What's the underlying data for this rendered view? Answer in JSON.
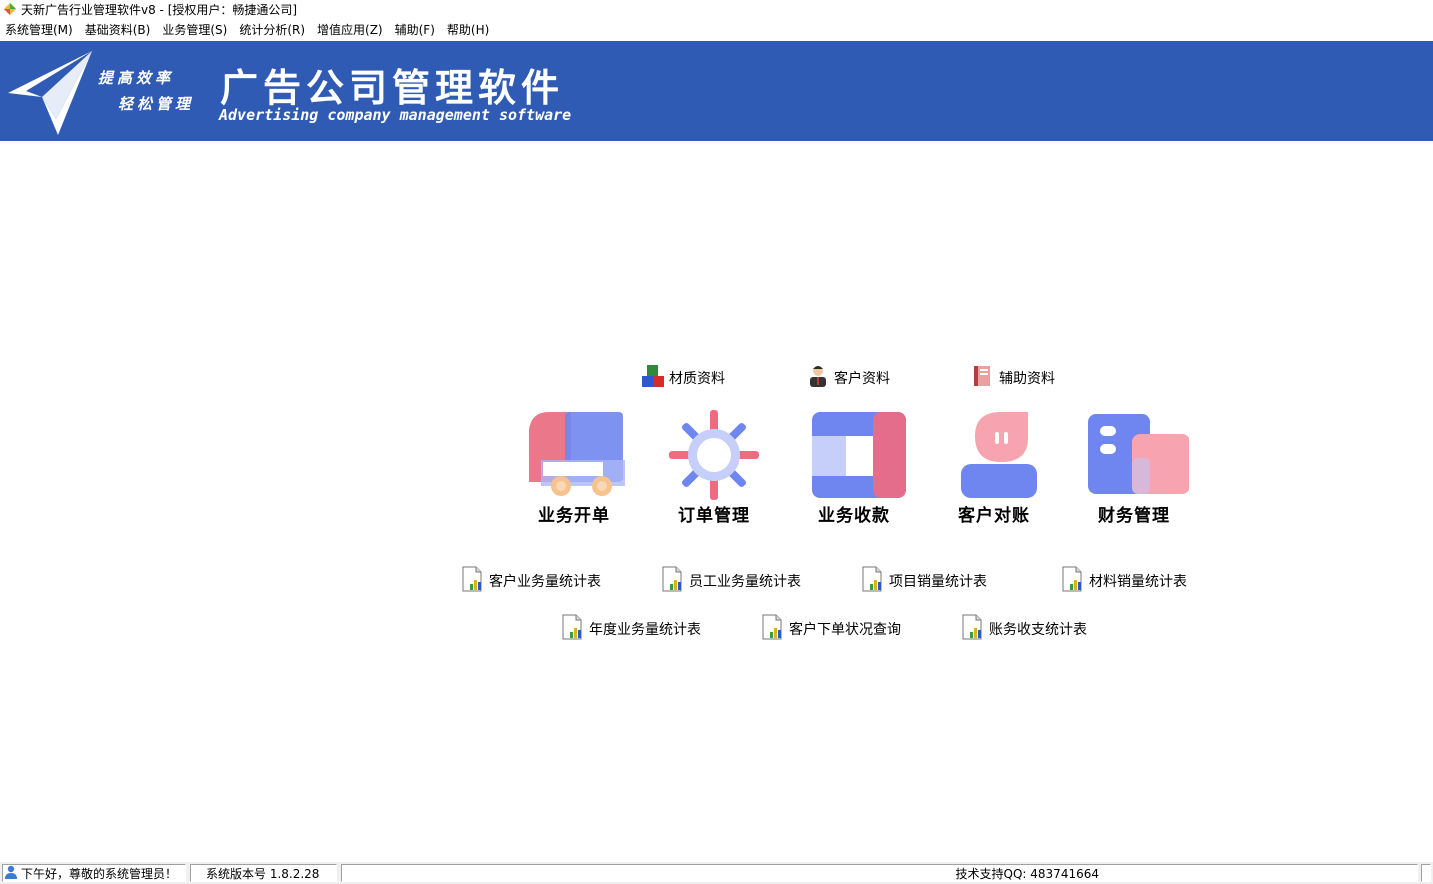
{
  "window": {
    "title": "天新广告行业管理软件v8 - [授权用户：畅捷通公司]"
  },
  "menu": [
    "系统管理(M)",
    "基础资料(B)",
    "业务管理(S)",
    "统计分析(R)",
    "增值应用(Z)",
    "辅助(F)",
    "帮助(H)"
  ],
  "banner": {
    "slogan1": "提高效率",
    "slogan2": "轻松管理",
    "title": "广告公司管理软件",
    "subtitle": "Advertising company management software",
    "bg_color": "#2f5bb5"
  },
  "quick_links": [
    {
      "label": "材质资料",
      "icon": "material-icon"
    },
    {
      "label": "客户资料",
      "icon": "customer-icon"
    },
    {
      "label": "辅助资料",
      "icon": "auxiliary-icon"
    }
  ],
  "modules": [
    {
      "label": "业务开单",
      "icon": "truck-icon"
    },
    {
      "label": "订单管理",
      "icon": "gear-icon"
    },
    {
      "label": "业务收款",
      "icon": "frame-icon"
    },
    {
      "label": "客户对账",
      "icon": "person-icon"
    },
    {
      "label": "财务管理",
      "icon": "building-icon"
    }
  ],
  "reports": [
    {
      "label": "客户业务量统计表"
    },
    {
      "label": "员工业务量统计表"
    },
    {
      "label": "项目销量统计表"
    },
    {
      "label": "材料销量统计表"
    },
    {
      "label": "年度业务量统计表"
    },
    {
      "label": "客户下单状况查询"
    },
    {
      "label": "账务收支统计表"
    }
  ],
  "status": {
    "greeting": "下午好，尊敬的系统管理员！",
    "version": "系统版本号 1.8.2.28",
    "support": "技术支持QQ: 483741664"
  }
}
